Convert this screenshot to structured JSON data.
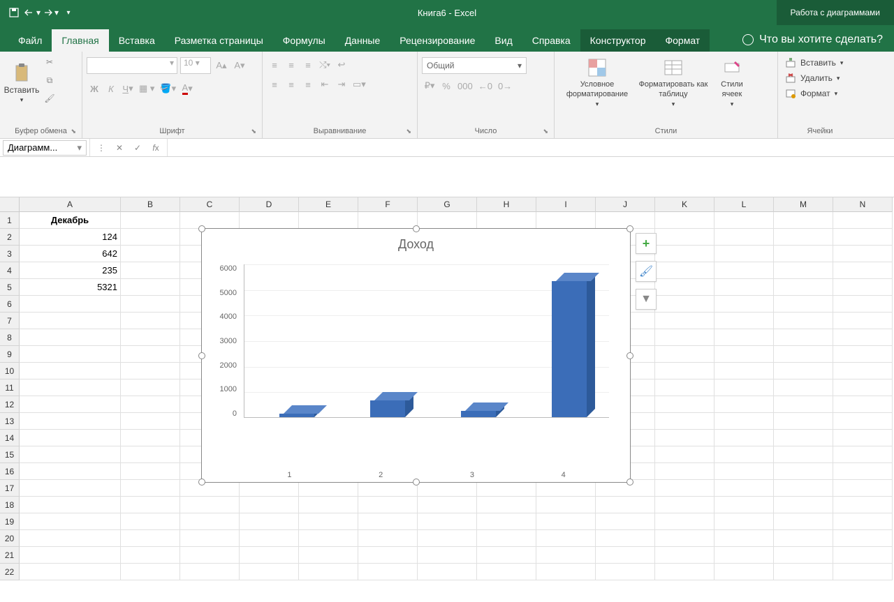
{
  "titlebar": {
    "title": "Книга6  -  Excel",
    "context_tab": "Работа с диаграммами"
  },
  "tabs": [
    "Файл",
    "Главная",
    "Вставка",
    "Разметка страницы",
    "Формулы",
    "Данные",
    "Рецензирование",
    "Вид",
    "Справка",
    "Конструктор",
    "Формат"
  ],
  "active_tab": "Главная",
  "tell_me": "Что вы хотите сделать?",
  "ribbon": {
    "clipboard": {
      "paste": "Вставить",
      "label": "Буфер обмена"
    },
    "font": {
      "size": "10",
      "label": "Шрифт",
      "bold": "Ж",
      "italic": "К",
      "underline": "Ч"
    },
    "alignment": {
      "label": "Выравнивание"
    },
    "number": {
      "format": "Общий",
      "label": "Число"
    },
    "styles": {
      "cond": "Условное форматирование",
      "table": "Форматировать как таблицу",
      "cell": "Стили ячеек",
      "label": "Стили"
    },
    "cells": {
      "insert": "Вставить",
      "delete": "Удалить",
      "format": "Формат",
      "label": "Ячейки"
    }
  },
  "name_box": "Диаграмм...",
  "columns": [
    "A",
    "B",
    "C",
    "D",
    "E",
    "F",
    "G",
    "H",
    "I",
    "J",
    "K",
    "L",
    "M",
    "N"
  ],
  "rows": [
    "1",
    "2",
    "3",
    "4",
    "5",
    "6",
    "7",
    "8",
    "9",
    "10",
    "11",
    "12",
    "13",
    "14",
    "15",
    "16",
    "17",
    "18",
    "19",
    "20",
    "21",
    "22"
  ],
  "sheet": {
    "A1": "Декабрь",
    "A2": "124",
    "A3": "642",
    "A4": "235",
    "A5": "5321"
  },
  "chart_data": {
    "type": "bar",
    "title": "Доход",
    "categories": [
      "1",
      "2",
      "3",
      "4"
    ],
    "values": [
      124,
      642,
      235,
      5321
    ],
    "y_ticks": [
      0,
      1000,
      2000,
      3000,
      4000,
      5000,
      6000
    ],
    "ylim": [
      0,
      6000
    ],
    "xlabel": "",
    "ylabel": ""
  }
}
